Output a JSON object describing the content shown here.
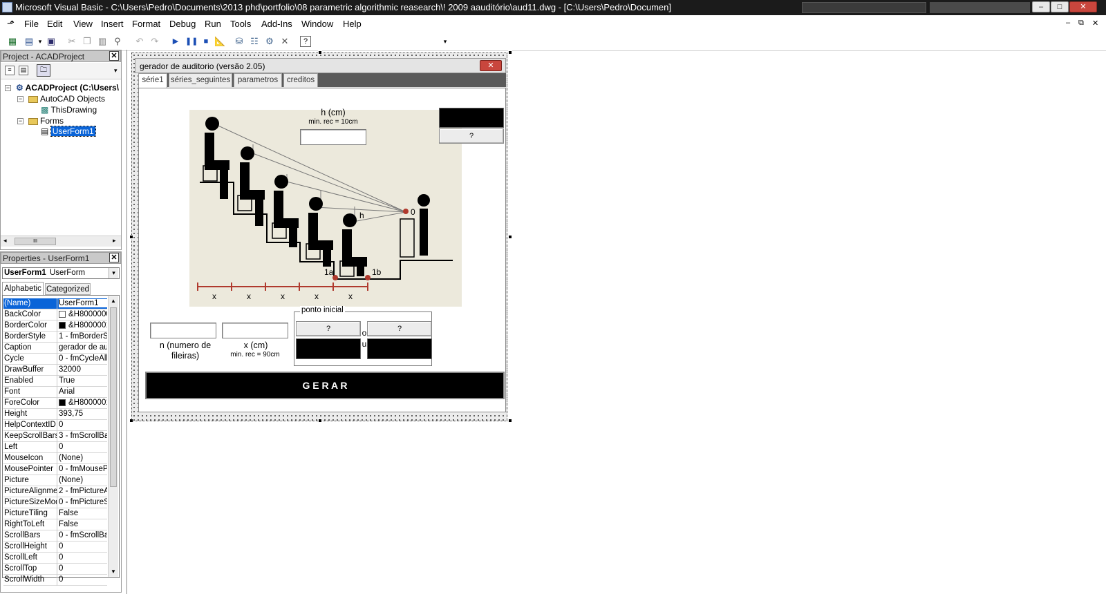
{
  "window": {
    "title": "Microsoft Visual Basic - C:\\Users\\Pedro\\Documents\\2013 phd\\portfolio\\08 parametric algorithmic reasearch\\! 2009 aauditório\\aud11.dwg - [C:\\Users\\Pedro\\Documen]",
    "minimize": "–",
    "maximize": "□",
    "close": "✕"
  },
  "menu": [
    "File",
    "Edit",
    "View",
    "Insert",
    "Format",
    "Debug",
    "Run",
    "Tools",
    "Add-Ins",
    "Window",
    "Help"
  ],
  "mdi_controls": [
    "–",
    "⧉",
    "✕"
  ],
  "toolbar": {
    "icons": [
      "view-acad-icon",
      "insert-userform-icon",
      "save-icon",
      "cut-icon",
      "copy-icon",
      "paste-icon",
      "find-icon",
      "undo-icon",
      "redo-icon",
      "run-icon",
      "break-icon",
      "reset-icon",
      "design-mode-icon",
      "project-explorer-icon",
      "properties-window-icon",
      "object-browser-icon",
      "toolbox-icon",
      "help-icon"
    ],
    "help_label": "?"
  },
  "project": {
    "header": "Project - ACADProject",
    "root": "ACADProject (C:\\Users\\",
    "autocad_objects": "AutoCAD Objects",
    "this_drawing": "ThisDrawing",
    "forms": "Forms",
    "userform": "UserForm1",
    "scroll_thumb": "III"
  },
  "properties": {
    "header": "Properties - UserForm1",
    "object_name": "UserForm1",
    "object_type": "UserForm",
    "tabs": [
      "Alphabetic",
      "Categorized"
    ],
    "rows": [
      {
        "name": "(Name)",
        "value": "UserForm1"
      },
      {
        "name": "BackColor",
        "value": "&H8000000"
      },
      {
        "name": "BorderColor",
        "value": "&H8000001"
      },
      {
        "name": "BorderStyle",
        "value": "1 - fmBorderSt"
      },
      {
        "name": "Caption",
        "value": "gerador de aud"
      },
      {
        "name": "Cycle",
        "value": "0 - fmCycleAllF"
      },
      {
        "name": "DrawBuffer",
        "value": "32000"
      },
      {
        "name": "Enabled",
        "value": "True"
      },
      {
        "name": "Font",
        "value": "Arial"
      },
      {
        "name": "ForeColor",
        "value": "&H8000001"
      },
      {
        "name": "Height",
        "value": "393,75"
      },
      {
        "name": "HelpContextID",
        "value": "0"
      },
      {
        "name": "KeepScrollBarsV",
        "value": "3 - fmScrollBar"
      },
      {
        "name": "Left",
        "value": "0"
      },
      {
        "name": "MouseIcon",
        "value": "(None)"
      },
      {
        "name": "MousePointer",
        "value": "0 - fmMousePo"
      },
      {
        "name": "Picture",
        "value": "(None)"
      },
      {
        "name": "PictureAlignmen",
        "value": "2 - fmPictureAl"
      },
      {
        "name": "PictureSizeMode",
        "value": "0 - fmPictureSi"
      },
      {
        "name": "PictureTiling",
        "value": "False"
      },
      {
        "name": "RightToLeft",
        "value": "False"
      },
      {
        "name": "ScrollBars",
        "value": "0 - fmScrollBar"
      },
      {
        "name": "ScrollHeight",
        "value": "0"
      },
      {
        "name": "ScrollLeft",
        "value": "0"
      },
      {
        "name": "ScrollTop",
        "value": "0"
      },
      {
        "name": "ScrollWidth",
        "value": "0"
      }
    ]
  },
  "form": {
    "caption": "gerador de auditorio (versão 2.05)",
    "tabs": [
      "série1",
      "séries_seguintes",
      "parametros",
      "creditos"
    ],
    "h_label": "h (cm)",
    "h_min": "min. rec = 10cm",
    "help_btn": "?",
    "n_label": "n (numero de fileiras)",
    "x_label": "x (cm)",
    "x_min": "min. rec = 90cm",
    "ponto_inicial": "ponto inicial",
    "ponto_q1": "?",
    "ponto_q2": "?",
    "ou_label": "ou",
    "gerar": "G E R A R",
    "diagram": {
      "label_0": "0",
      "label_h": "h",
      "label_1a": "1a",
      "label_1b": "1b",
      "x_marks": [
        "x",
        "x",
        "x",
        "x",
        "x"
      ]
    }
  },
  "colors": {
    "diagram_bg": "#ece9dc",
    "red_marker": "#b03a2e",
    "titlebar": "#1b1b1b",
    "selection": "#0a64d8"
  }
}
